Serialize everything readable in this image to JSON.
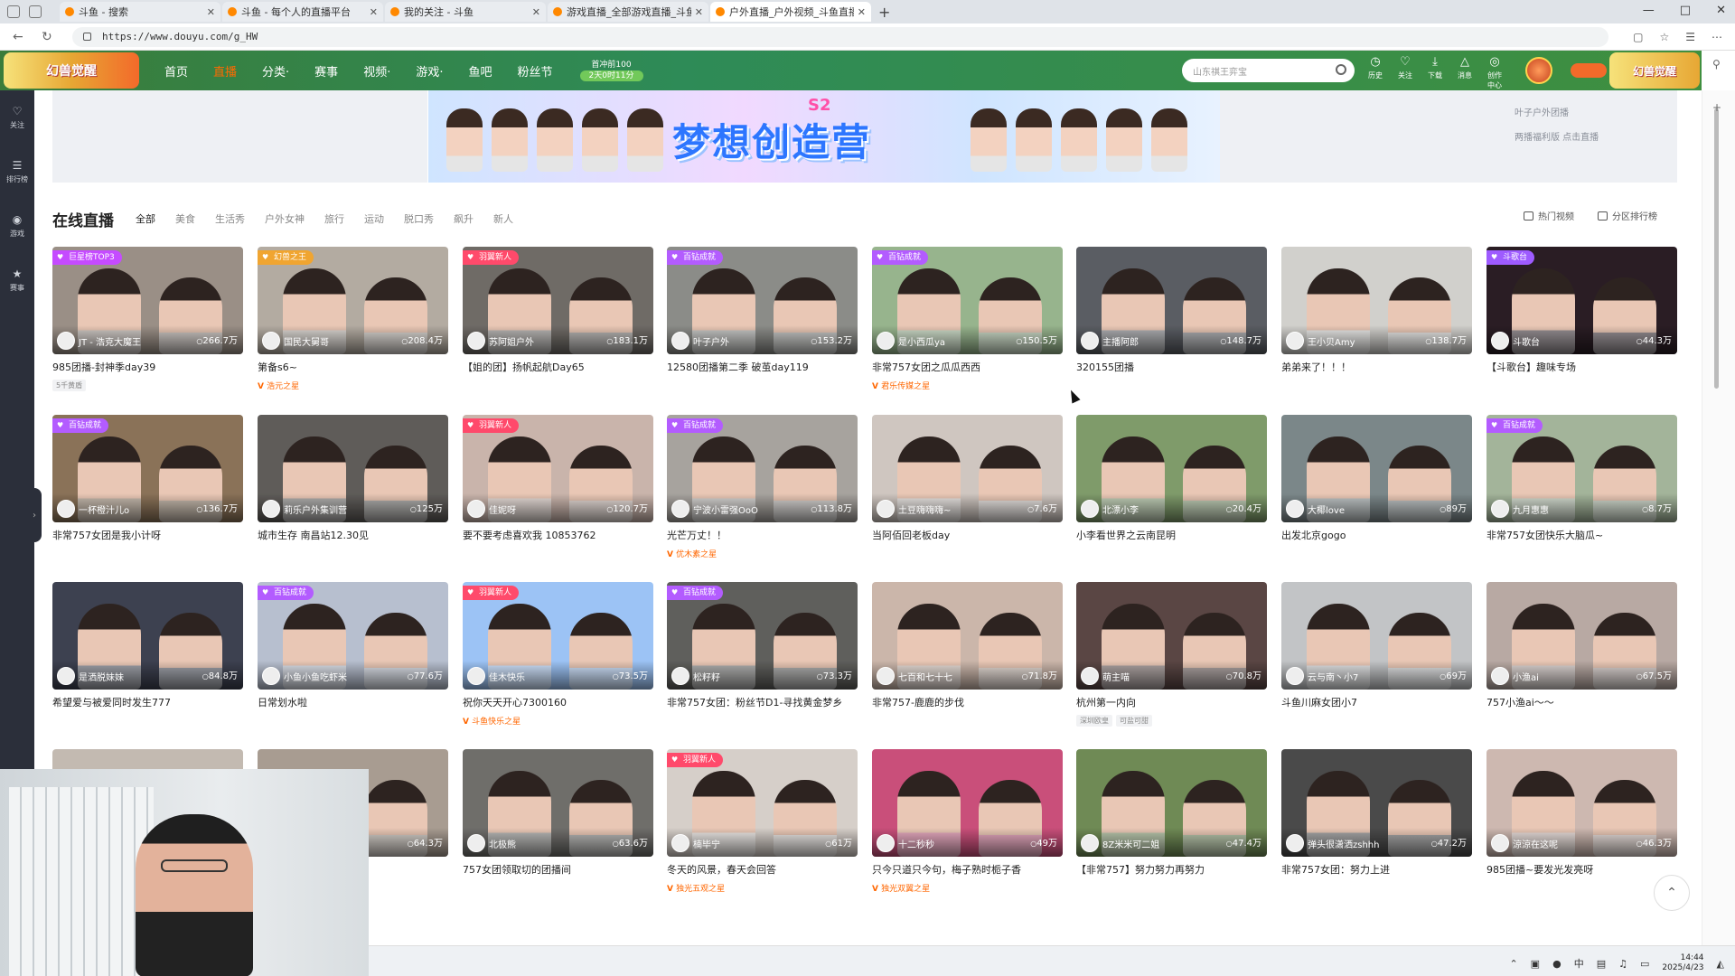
{
  "browser": {
    "tabs": [
      {
        "title": "斗鱼 - 搜索"
      },
      {
        "title": "斗鱼 - 每个人的直播平台"
      },
      {
        "title": "我的关注 - 斗鱼"
      },
      {
        "title": "游戏直播_全部游戏直播_斗鱼直播"
      },
      {
        "title": "户外直播_户外视频_斗鱼直播",
        "active": true
      }
    ],
    "url": "https://www.douyu.com/g_HW",
    "new_tab": "+"
  },
  "header": {
    "logo_text": "幻兽觉醒",
    "logo_right_text": "幻兽觉醒",
    "nav": [
      "首页",
      "直播",
      "分类·",
      "赛事",
      "视频·",
      "游戏·",
      "鱼吧",
      "粉丝节"
    ],
    "active_nav": "直播",
    "promo_line1": "首冲前100",
    "promo_line2": "2天0时11分",
    "search_placeholder": "山东祺王弈宝",
    "icons": [
      {
        "name": "history",
        "label": "历史"
      },
      {
        "name": "follow",
        "label": "关注"
      },
      {
        "name": "download",
        "label": "下载"
      },
      {
        "name": "message",
        "label": "消息"
      },
      {
        "name": "creator",
        "label": "创作中心"
      }
    ]
  },
  "left_rail": [
    {
      "name": "follow",
      "label": "关注"
    },
    {
      "name": "rank",
      "label": "排行榜"
    },
    {
      "name": "game",
      "label": "游戏"
    },
    {
      "name": "match",
      "label": "赛事"
    }
  ],
  "banner": {
    "title": "梦想创造营",
    "badge": "S2",
    "side_menu": [
      "叶子户外团播",
      "两播福利版 点击直播"
    ]
  },
  "section": {
    "title": "在线直播",
    "filters": [
      "全部",
      "美食",
      "生活秀",
      "户外女神",
      "旅行",
      "运动",
      "脱口秀",
      "飙升",
      "新人"
    ],
    "active_filter": "全部",
    "btn_hot": "热门视频",
    "btn_rank": "分区排行榜"
  },
  "cards": [
    {
      "tag": "巨星榜TOP3",
      "tag_color": "#c54bff",
      "anchor": "JT - 浩克大魔王",
      "viewers": "266.7万",
      "title": "985团播-封神季day39",
      "chip": "5千黄盾",
      "bg": "#9a8f86"
    },
    {
      "tag": "幻兽之王",
      "tag_color": "#f0a531",
      "anchor": "国民大舅哥",
      "viewers": "208.4万",
      "title": "第备s6~",
      "sub": "浩元之星",
      "bg": "#b3aba1"
    },
    {
      "tag": "羽翼新人",
      "tag_color": "#ff4a6b",
      "anchor": "苏阿姐户外",
      "viewers": "183.1万",
      "title": "【姐的团】扬帆起航Day65",
      "bg": "#6f6b66"
    },
    {
      "tag": "百钻成就",
      "tag_color": "#b35cff",
      "anchor": "叶子户外",
      "viewers": "153.2万",
      "title": "12580团播第二季 破茧day119",
      "bg": "#8b8c88"
    },
    {
      "tag": "百钻成就",
      "tag_color": "#b35cff",
      "anchor": "是小西瓜ya",
      "viewers": "150.5万",
      "title": "非常757女团之瓜瓜西西",
      "sub": "君乐传媒之星",
      "bg": "#97b48d"
    },
    {
      "anchor": "主播阿郎",
      "viewers": "148.7万",
      "title": "320155团播",
      "bg": "#5a5d63"
    },
    {
      "anchor": "王小贝Amy",
      "viewers": "138.7万",
      "title": "弟弟来了！！！",
      "bg": "#d1d0cc"
    },
    {
      "tag": "斗歌台",
      "tag_color": "#9e5bff",
      "anchor": "斗歌台",
      "viewers": "44.3万",
      "title": "【斗歌台】趣味专场",
      "bg": "#2a1d24"
    },
    {
      "tag": "百钻成就",
      "tag_color": "#b35cff",
      "anchor": "一杯橙汁儿o",
      "viewers": "136.7万",
      "title": "非常757女团是我小计呀",
      "bg": "#8a7258"
    },
    {
      "anchor": "莉乐户外集训营",
      "viewers": "125万",
      "title": "城市生存 南昌站12.30见",
      "bg": "#5f5c59"
    },
    {
      "tag": "羽翼新人",
      "tag_color": "#ff4a6b",
      "anchor": "佳妮呀",
      "viewers": "120.7万",
      "title": "要不要考虑喜欢我 10853762",
      "bg": "#c9b4ab"
    },
    {
      "tag": "百钻成就",
      "tag_color": "#b35cff",
      "anchor": "宁波小雷强OoO",
      "viewers": "113.8万",
      "title": "光芒万丈！！",
      "sub": "优木素之星",
      "bg": "#a7a39e"
    },
    {
      "anchor": "土豆嗨嗨嗨~",
      "viewers": "7.6万",
      "title": "当阿佰回老板day",
      "bg": "#cfc6c0"
    },
    {
      "anchor": "北漂小李",
      "viewers": "20.4万",
      "title": "小李看世界之云南昆明",
      "bg": "#7f9b6a"
    },
    {
      "anchor": "大椰love",
      "viewers": "89万",
      "title": "出发北京gogo",
      "bg": "#7b8789"
    },
    {
      "tag": "百钻成就",
      "tag_color": "#b35cff",
      "anchor": "九月惠惠",
      "viewers": "8.7万",
      "title": "非常757女团快乐大脑瓜~",
      "bg": "#a3b49a"
    },
    {
      "anchor": "是洒脱妹妹",
      "viewers": "84.8万",
      "title": "希望爱与被爱同时发生777",
      "bg": "#3d4150"
    },
    {
      "tag": "百钻成就",
      "tag_color": "#b35cff",
      "anchor": "小鱼小鱼吃虾米",
      "viewers": "77.6万",
      "title": "日常划水啦",
      "bg": "#b7bfcf"
    },
    {
      "tag": "羽翼新人",
      "tag_color": "#ff4a6b",
      "anchor": "佳木快乐",
      "viewers": "73.5万",
      "title": "祝你天天开心7300160",
      "sub": "斗鱼快乐之星",
      "bg": "#9cc3f5"
    },
    {
      "tag": "百钻成就",
      "tag_color": "#b35cff",
      "anchor": "松籽籽",
      "viewers": "73.3万",
      "title": "非常757女团：粉丝节D1-寻找黄金梦乡",
      "bg": "#5f5f5c"
    },
    {
      "anchor": "七百和七十七",
      "viewers": "71.8万",
      "title": "非常757-鹿鹿的步伐",
      "bg": "#cbb6aa"
    },
    {
      "anchor": "萌主喵",
      "viewers": "70.8万",
      "title": "杭州第一内向",
      "chips": [
        "深圳欧皇",
        "可盐可甜"
      ],
      "bg": "#5a4644"
    },
    {
      "anchor": "云与南丶小7",
      "viewers": "69万",
      "title": "斗鱼川麻女团小7",
      "bg": "#c2c4c6"
    },
    {
      "anchor": "小渔ai",
      "viewers": "67.5万",
      "title": "757小渔ai～～",
      "bg": "#b8a9a3"
    },
    {
      "anchor": "",
      "viewers": "",
      "title": "",
      "bg": "#c3bab1"
    },
    {
      "anchor": "",
      "viewers": "64.3万",
      "title": "",
      "bg": "#a89c91"
    },
    {
      "anchor": "北极熊",
      "viewers": "63.6万",
      "title": "757女团领取切的团播间",
      "bg": "#6f6e6a"
    },
    {
      "tag": "羽翼新人",
      "tag_color": "#ff4a6b",
      "anchor": "楠毕宁",
      "viewers": "61万",
      "title": "冬天的风景，春天会回答",
      "sub": "独光五观之星",
      "bg": "#d6cfc9"
    },
    {
      "anchor": "十二秒秒",
      "viewers": "49万",
      "title": "只今只道只今句，梅子熟时栀子香",
      "sub": "独光双翼之星",
      "bg": "#c94f7a"
    },
    {
      "anchor": "8Z米米可二姐",
      "viewers": "47.4万",
      "title": "【非常757】努力努力再努力",
      "bg": "#6f8a55"
    },
    {
      "anchor": "弹头很潇洒zshhh",
      "viewers": "47.2万",
      "title": "非常757女团：努力上进",
      "bg": "#4a4a4a"
    },
    {
      "anchor": "涼涼在这呢",
      "viewers": "46.3万",
      "title": "985团播~要发光发亮呀",
      "bg": "#cdb8b0"
    }
  ],
  "taskbar": {
    "time": "14:44",
    "date": "2025/4/23",
    "tray": [
      "中"
    ]
  }
}
